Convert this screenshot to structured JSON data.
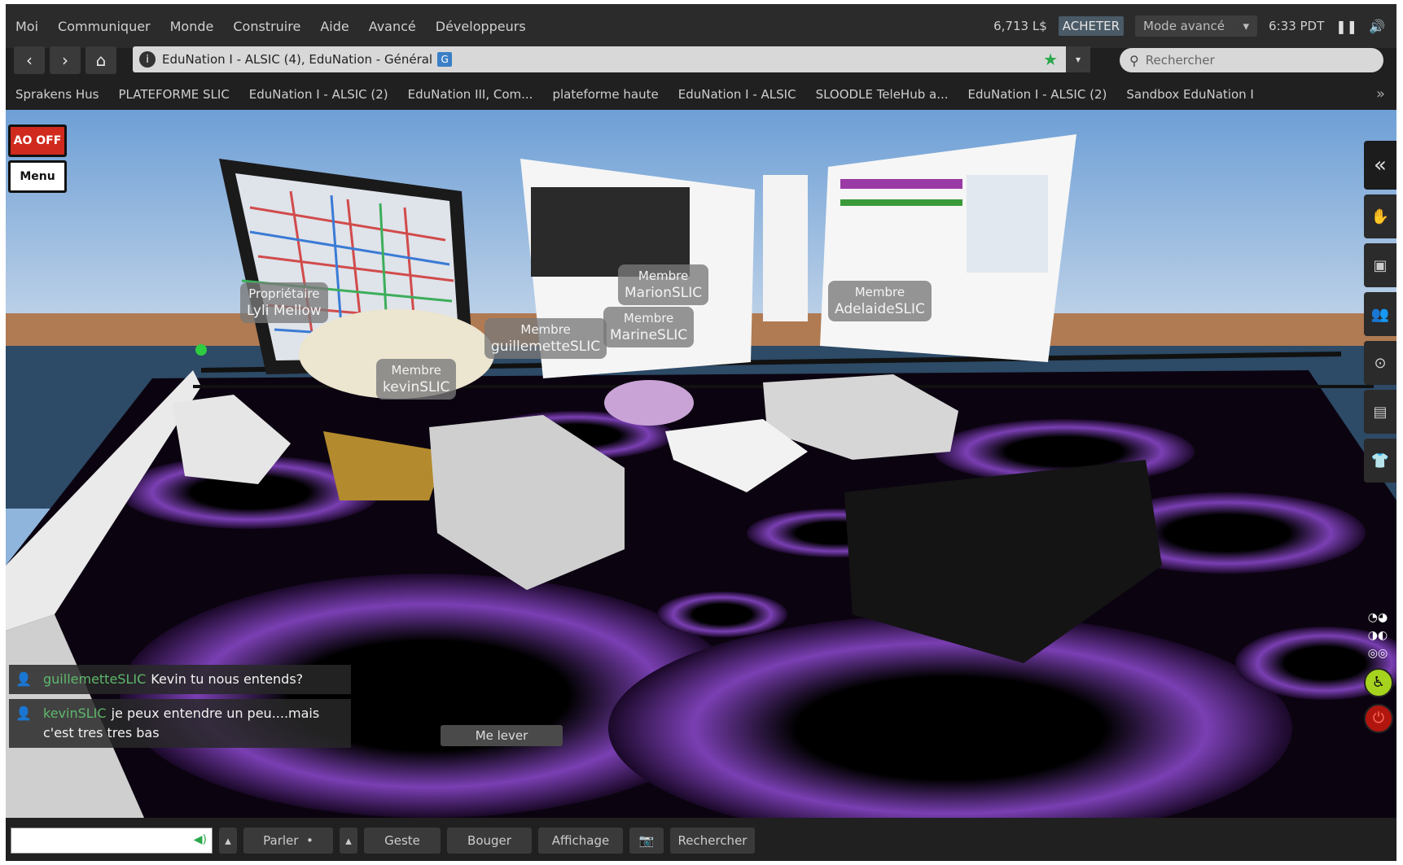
{
  "menubar": {
    "items": [
      "Moi",
      "Communiquer",
      "Monde",
      "Construire",
      "Aide",
      "Avancé",
      "Développeurs"
    ],
    "balance": "6,713 L$",
    "buy_label": "ACHETER",
    "mode_label": "Mode avancé",
    "clock": "6:33 PDT",
    "icons": [
      "pause-icon",
      "speaker-icon"
    ]
  },
  "navbar": {
    "location": "EduNation I - ALSIC (4), EduNation - Général",
    "location_badge": "G",
    "search_placeholder": "Rechercher"
  },
  "favorites": [
    "Sprakens Hus",
    "PLATEFORME SLIC",
    "EduNation I - ALSIC (2)",
    "EduNation III, Com...",
    "plateforme haute",
    "EduNation I - ALSIC",
    "SLOODLE TeleHub a...",
    "EduNation I - ALSIC (2)",
    "Sandbox EduNation I"
  ],
  "hud": {
    "ao_label": "AO OFF",
    "menu_label": "Menu"
  },
  "name_tags": [
    {
      "role": "Propriétaire",
      "name": "Lyli Mellow"
    },
    {
      "role": "Membre",
      "name": "kevinSLIC"
    },
    {
      "role": "Membre",
      "name": "guillemetteSLIC"
    },
    {
      "role": "Membre",
      "name": "MarionSLIC"
    },
    {
      "role": "Membre",
      "name": "MarineSLIC"
    },
    {
      "role": "Membre",
      "name": "AdelaideSLIC"
    }
  ],
  "chat": [
    {
      "who": "guillemetteSLIC",
      "text": "Kevin tu nous entends?"
    },
    {
      "who": "kevinSLIC",
      "text": "je peux entendre un peu....mais c'est tres tres bas"
    }
  ],
  "stand_up_label": "Me lever",
  "bottombar": {
    "speak": "Parler",
    "gesture": "Geste",
    "move": "Bouger",
    "view": "Affichage",
    "search": "Rechercher"
  }
}
